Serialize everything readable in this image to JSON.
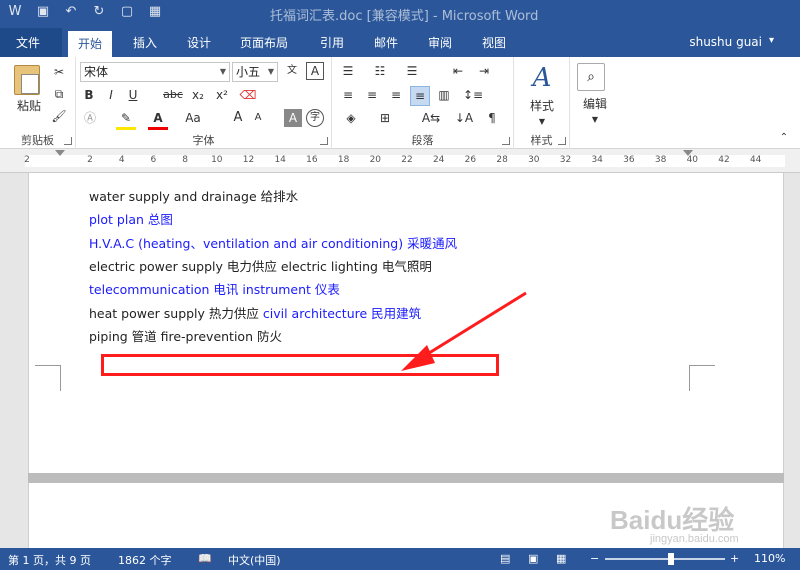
{
  "window": {
    "title": "托福词汇表.doc [兼容模式] - Microsoft Word",
    "user": "shushu guai"
  },
  "tabs": [
    "文件",
    "开始",
    "插入",
    "设计",
    "页面布局",
    "引用",
    "邮件",
    "审阅",
    "视图"
  ],
  "ribbon": {
    "clipboard": {
      "label": "剪贴板",
      "paste": "粘贴"
    },
    "font": {
      "label": "字体",
      "name": "宋体",
      "size": "小五",
      "bold": "B",
      "italic": "I",
      "underline": "U",
      "strike": "abc",
      "sub": "x₂",
      "sup": "x²",
      "grow": "A",
      "shrink": "A",
      "case": "Aa"
    },
    "paragraph": {
      "label": "段落"
    },
    "styles": {
      "label": "样式",
      "button": "样式"
    },
    "editing": {
      "button": "编辑"
    }
  },
  "ruler": {
    "ticks": [
      "2",
      "2",
      "4",
      "6",
      "8",
      "10",
      "12",
      "14",
      "16",
      "18",
      "20",
      "22",
      "24",
      "26",
      "28",
      "30",
      "32",
      "34",
      "36",
      "38",
      "40",
      "42",
      "44"
    ]
  },
  "document": {
    "lines": [
      {
        "segments": [
          {
            "text": "water supply and drainage  给排水",
            "color": "black"
          }
        ]
      },
      {
        "segments": [
          {
            "text": "plot plan  总图",
            "color": "blue"
          }
        ]
      },
      {
        "segments": [
          {
            "text": "H.V.A.C (heating、ventilation and air conditioning)  采暖通风",
            "color": "blue"
          }
        ]
      },
      {
        "segments": [
          {
            "text": "electric power supply  电力供应 electric lighting  电气照明",
            "color": "black"
          }
        ]
      },
      {
        "segments": [
          {
            "text": "telecommunication  电讯 instrument  仪表",
            "color": "blue"
          }
        ]
      },
      {
        "segments": [
          {
            "text": "heat power supply  热力供应 ",
            "color": "black"
          },
          {
            "text": "civil architecture  民用建筑",
            "color": "blue"
          }
        ]
      },
      {
        "segments": [
          {
            "text": "piping  管道 fire-prevention  防火",
            "color": "black"
          }
        ]
      }
    ]
  },
  "status": {
    "page": "第 1 页，共 9 页",
    "words": "1862 个字",
    "language": "中文(中国)",
    "zoom": "110%"
  },
  "watermark": {
    "brand": "Baidu经验",
    "url": "jingyan.baidu.com"
  },
  "colors": {
    "accent": "#2b579a",
    "highlight": "#ff1c1c",
    "link_blue": "#1a1aff"
  }
}
